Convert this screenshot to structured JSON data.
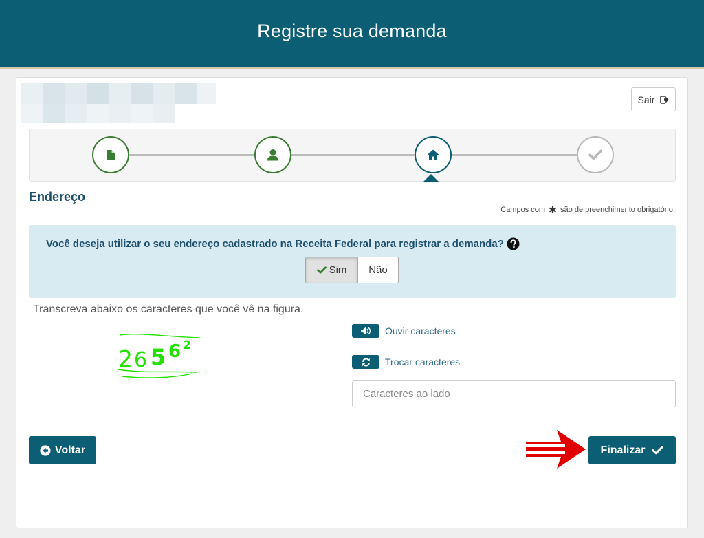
{
  "header": {
    "title": "Registre sua demanda"
  },
  "user_block": {
    "redacted": true
  },
  "logout": {
    "label": "Sair",
    "icon": "sign-out-icon"
  },
  "stepper": {
    "steps": [
      {
        "icon": "file-icon",
        "state": "done"
      },
      {
        "icon": "user-icon",
        "state": "done"
      },
      {
        "icon": "home-icon",
        "state": "active"
      },
      {
        "icon": "check-icon",
        "state": "todo"
      }
    ]
  },
  "section": {
    "title": "Endereço",
    "required_note_prefix": "Campos com",
    "required_note_suffix": "são de preenchimento obrigatório."
  },
  "address_question": {
    "text": "Você deseja utilizar o seu endereço cadastrado na Receita Federal para registrar a demanda?",
    "help_icon": "question-circle-icon",
    "options": {
      "yes": "Sim",
      "no": "Não"
    },
    "selected": "Sim"
  },
  "captcha": {
    "instruction": "Transcreva abaixo os caracteres que você vê na figura.",
    "image_text": "26562",
    "listen_label": "Ouvir caracteres",
    "listen_icon": "volume-icon",
    "refresh_label": "Trocar caracteres",
    "refresh_icon": "refresh-icon",
    "input_placeholder": "Caracteres ao lado",
    "input_value": ""
  },
  "actions": {
    "back_label": "Voltar",
    "back_icon": "arrow-circle-left-icon",
    "finish_label": "Finalizar",
    "finish_icon": "check-icon"
  },
  "colors": {
    "primary": "#0c5e75",
    "header_accent": "#d8c9a4",
    "step_done": "#3a7d32",
    "info_panel": "#d8ebf3",
    "captcha_green": "#22e000",
    "annotation_arrow": "#e00000"
  }
}
